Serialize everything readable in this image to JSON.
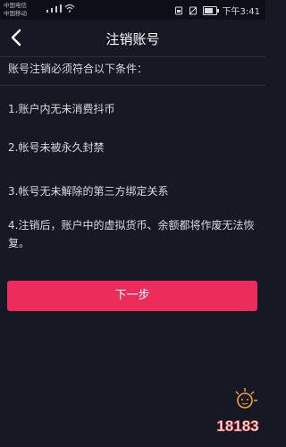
{
  "status_bar": {
    "carrier_1": "中国电信",
    "carrier_2": "中国移动",
    "time": "下午3:41"
  },
  "nav": {
    "title": "注销账号",
    "back_icon": "chevron-left-icon"
  },
  "content": {
    "intro": "账号注销必须符合以下条件：",
    "conditions": [
      "1.账户内无未消费抖币",
      "2.帐号未被永久封禁",
      "3.帐号无未解除的第三方绑定关系",
      "4.注销后，账户中的虚拟货币、余额都将作废无法恢复。"
    ]
  },
  "actions": {
    "next_label": "下一步"
  },
  "watermark": {
    "text": "18183"
  },
  "colors": {
    "background": "#161823",
    "accent": "#ec2c5a",
    "text": "#d9d9de"
  }
}
